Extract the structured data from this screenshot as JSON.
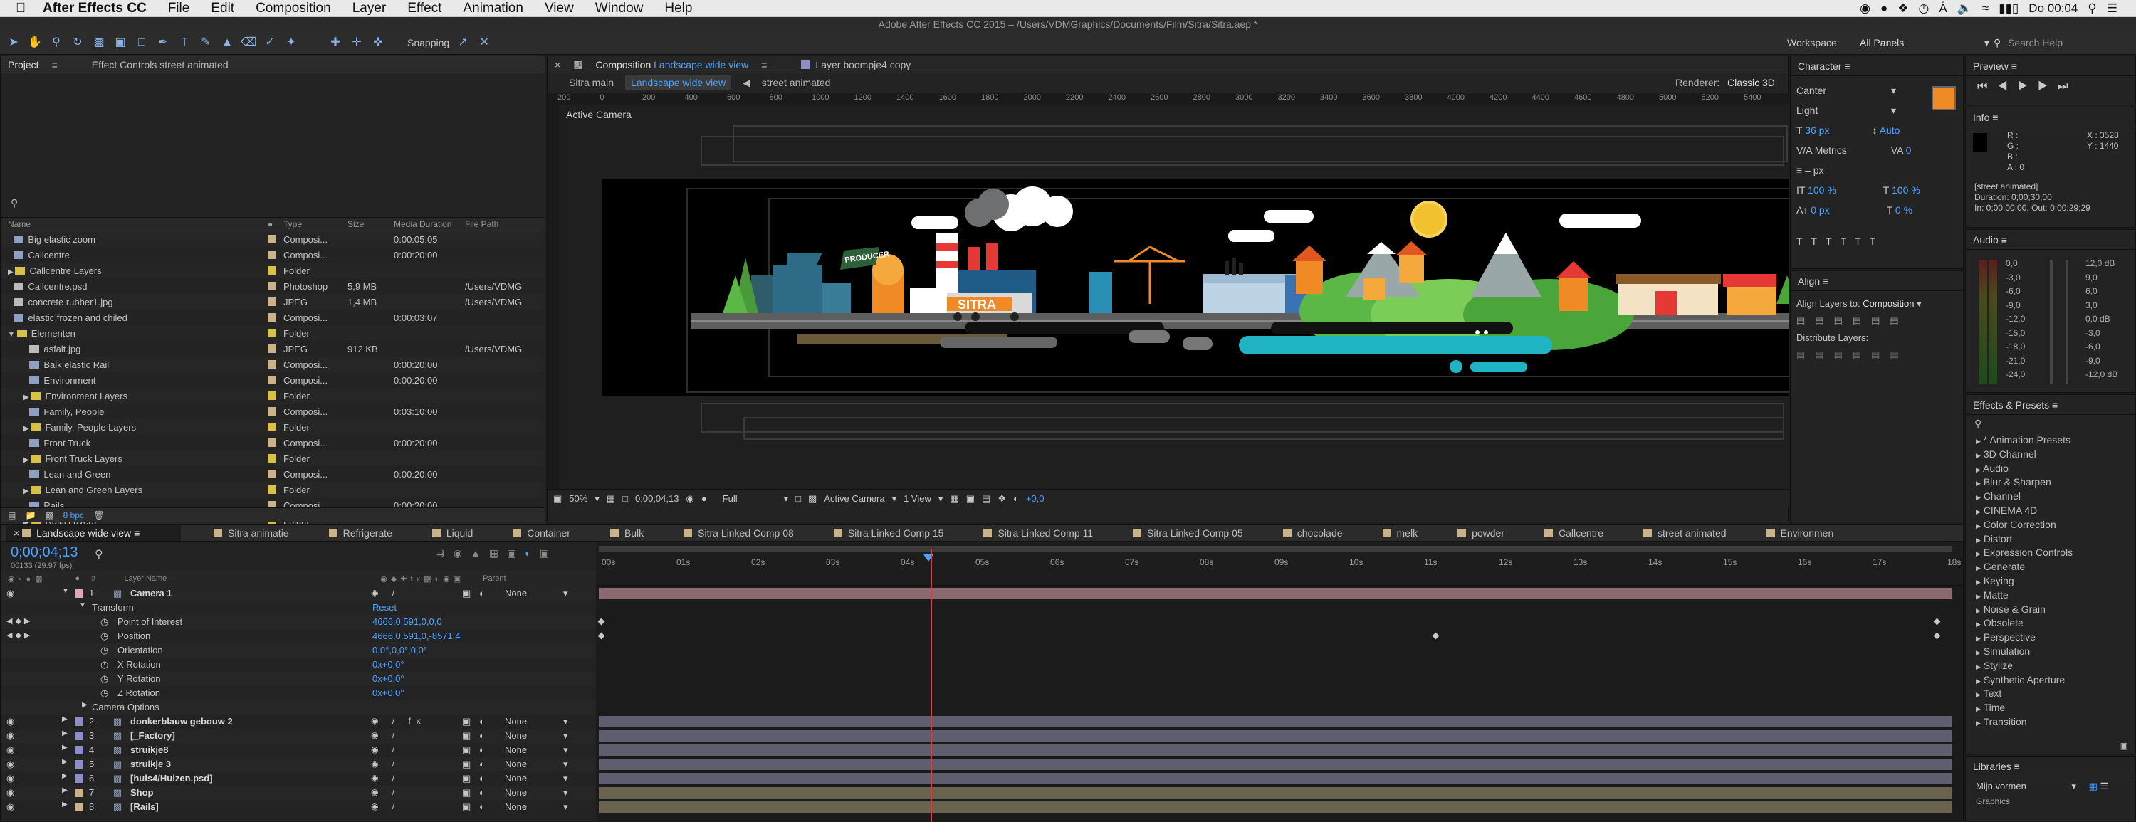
{
  "menubar": {
    "app": "After Effects CC",
    "items": [
      "File",
      "Edit",
      "Composition",
      "Layer",
      "Effect",
      "Animation",
      "View",
      "Window",
      "Help"
    ],
    "clock": "Do 00:04"
  },
  "title": "Adobe After Effects CC 2015 – /Users/VDMGraphics/Documents/Film/Sitra/Sitra.aep *",
  "toolbar": {
    "snapping": "Snapping",
    "workspace_label": "Workspace:",
    "workspace": "All Panels",
    "search": "Search Help"
  },
  "project": {
    "tabs": [
      "Project",
      "Effect Controls street animated"
    ],
    "columns": [
      "Name",
      "Type",
      "Size",
      "Media Duration",
      "File Path"
    ],
    "rows": [
      {
        "name": "Big elastic zoom",
        "type": "Composi...",
        "size": "",
        "dur": "0:00:05:05",
        "path": "",
        "color": "#c9b38a",
        "kind": "comp",
        "indent": 0
      },
      {
        "name": "Callcentre",
        "type": "Composi...",
        "size": "",
        "dur": "0:00:20:00",
        "path": "",
        "color": "#c9b38a",
        "kind": "comp",
        "indent": 0
      },
      {
        "name": "Callcentre Layers",
        "type": "Folder",
        "size": "",
        "dur": "",
        "path": "",
        "color": "#d7c14a",
        "kind": "folder",
        "indent": 0
      },
      {
        "name": "Callcentre.psd",
        "type": "Photoshop",
        "size": "5,9 MB",
        "dur": "",
        "path": "/Users/VDMG",
        "color": "#c9b38a",
        "kind": "file",
        "indent": 0
      },
      {
        "name": "concrete rubber1.jpg",
        "type": "JPEG",
        "size": "1,4 MB",
        "dur": "",
        "path": "/Users/VDMG",
        "color": "#c9b38a",
        "kind": "file",
        "indent": 0
      },
      {
        "name": "elastic frozen and chiled",
        "type": "Composi...",
        "size": "",
        "dur": "0:00:03:07",
        "path": "",
        "color": "#c9b38a",
        "kind": "comp",
        "indent": 0
      },
      {
        "name": "Elementen",
        "type": "Folder",
        "size": "",
        "dur": "",
        "path": "",
        "color": "#d7c14a",
        "kind": "folder-open",
        "indent": 0
      },
      {
        "name": "asfalt.jpg",
        "type": "JPEG",
        "size": "912 KB",
        "dur": "",
        "path": "/Users/VDMG",
        "color": "#c9b38a",
        "kind": "file",
        "indent": 1
      },
      {
        "name": "Balk elastic Rail",
        "type": "Composi...",
        "size": "",
        "dur": "0:00:20:00",
        "path": "",
        "color": "#c9b38a",
        "kind": "comp",
        "indent": 1
      },
      {
        "name": "Environment",
        "type": "Composi...",
        "size": "",
        "dur": "0:00:20:00",
        "path": "",
        "color": "#c9b38a",
        "kind": "comp",
        "indent": 1
      },
      {
        "name": "Environment Layers",
        "type": "Folder",
        "size": "",
        "dur": "",
        "path": "",
        "color": "#d7c14a",
        "kind": "folder",
        "indent": 1
      },
      {
        "name": "Family, People",
        "type": "Composi...",
        "size": "",
        "dur": "0:03:10:00",
        "path": "",
        "color": "#c9b38a",
        "kind": "comp",
        "indent": 1
      },
      {
        "name": "Family, People Layers",
        "type": "Folder",
        "size": "",
        "dur": "",
        "path": "",
        "color": "#d7c14a",
        "kind": "folder",
        "indent": 1
      },
      {
        "name": "Front Truck",
        "type": "Composi...",
        "size": "",
        "dur": "0:00:20:00",
        "path": "",
        "color": "#c9b38a",
        "kind": "comp",
        "indent": 1
      },
      {
        "name": "Front Truck Layers",
        "type": "Folder",
        "size": "",
        "dur": "",
        "path": "",
        "color": "#d7c14a",
        "kind": "folder",
        "indent": 1
      },
      {
        "name": "Lean and Green",
        "type": "Composi...",
        "size": "",
        "dur": "0:00:20:00",
        "path": "",
        "color": "#c9b38a",
        "kind": "comp",
        "indent": 1
      },
      {
        "name": "Lean and Green Layers",
        "type": "Folder",
        "size": "",
        "dur": "",
        "path": "",
        "color": "#d7c14a",
        "kind": "folder",
        "indent": 1
      },
      {
        "name": "Rails",
        "type": "Composi...",
        "size": "",
        "dur": "0:00:20:00",
        "path": "",
        "color": "#c9b38a",
        "kind": "comp",
        "indent": 1
      },
      {
        "name": "Rails Layers",
        "type": "Folder",
        "size": "",
        "dur": "",
        "path": "",
        "color": "#d7c14a",
        "kind": "folder",
        "indent": 1
      }
    ],
    "bpc": "8 bpc"
  },
  "comp": {
    "tab_prefix": "Composition",
    "tab_name": "Landscape wide view",
    "tab2": "Layer boompje4 copy",
    "crumbs": [
      "Sitra main",
      "Landscape wide view",
      "street animated"
    ],
    "renderer_label": "Renderer:",
    "renderer": "Classic 3D",
    "active_camera": "Active Camera",
    "ruler": [
      "200",
      "0",
      "200",
      "400",
      "600",
      "800",
      "1000",
      "1200",
      "1400",
      "1600",
      "1800",
      "2000",
      "2200",
      "2400",
      "2600",
      "2800",
      "3000",
      "3200",
      "3400",
      "3600",
      "3800",
      "4000",
      "4200",
      "4400",
      "4600",
      "4800",
      "5000",
      "5200",
      "5400"
    ],
    "footer": {
      "zoom": "50%",
      "timecode": "0;00;04;13",
      "resolution": "Full",
      "camera": "Active Camera",
      "views": "1 View",
      "exposure": "+0,0"
    },
    "sign": "PRODUCER",
    "truck": "SITRA"
  },
  "character": {
    "title": "Character",
    "font": "Canter",
    "style": "Light",
    "size": "36 px",
    "leading": "Auto",
    "kerning": "Metrics",
    "tracking": "0",
    "line": "– px",
    "vscale": "100 %",
    "hscale": "100 %",
    "baseline": "0 px",
    "tsume": "0 %",
    "fill": "#f08a24"
  },
  "align": {
    "title": "Align",
    "align_to_label": "Align Layers to:",
    "align_to": "Composition",
    "distribute": "Distribute Layers:"
  },
  "preview": {
    "title": "Preview"
  },
  "info": {
    "title": "Info",
    "r": "R :",
    "g": "G :",
    "b": "B :",
    "a": "A : 0",
    "x": "X : 3528",
    "y": "Y : 1440",
    "layer": "[street animated]",
    "duration": "Duration: 0;00;30;00",
    "inout": "In: 0;00;00;00, Out: 0;00;29;29"
  },
  "audio": {
    "title": "Audio",
    "left": [
      "0,0",
      "-3,0",
      "-6,0",
      "-9,0",
      "-12,0",
      "-15,0",
      "-18,0",
      "-21,0",
      "-24,0"
    ],
    "right": [
      "12,0 dB",
      "9,0",
      "6,0",
      "3,0",
      "0,0 dB",
      "-3,0",
      "-6,0",
      "-9,0",
      "-12,0 dB"
    ]
  },
  "effects": {
    "title": "Effects & Presets",
    "items": [
      "* Animation Presets",
      "3D Channel",
      "Audio",
      "Blur & Sharpen",
      "Channel",
      "CINEMA 4D",
      "Color Correction",
      "Distort",
      "Expression Controls",
      "Generate",
      "Keying",
      "Matte",
      "Noise & Grain",
      "Obsolete",
      "Perspective",
      "Simulation",
      "Stylize",
      "Synthetic Aperture",
      "Text",
      "Time",
      "Transition"
    ]
  },
  "libraries": {
    "title": "Libraries",
    "selected": "Mijn vormen",
    "section": "Graphics"
  },
  "timeline": {
    "tabs": [
      {
        "label": "Landscape wide view",
        "color": "#c9b38a"
      },
      {
        "label": "Sitra animatie",
        "color": "#c9b38a"
      },
      {
        "label": "Refrigerate",
        "color": "#c9b38a"
      },
      {
        "label": "Liquid",
        "color": "#c9b38a"
      },
      {
        "label": "Container",
        "color": "#c9b38a"
      },
      {
        "label": "Bulk",
        "color": "#c9b38a"
      },
      {
        "label": "Sitra Linked Comp 08",
        "color": "#c9b38a"
      },
      {
        "label": "Sitra Linked Comp 15",
        "color": "#c9b38a"
      },
      {
        "label": "Sitra Linked Comp 11",
        "color": "#c9b38a"
      },
      {
        "label": "Sitra Linked Comp 05",
        "color": "#c9b38a"
      },
      {
        "label": "chocolade",
        "color": "#c9b38a"
      },
      {
        "label": "melk",
        "color": "#c9b38a"
      },
      {
        "label": "powder",
        "color": "#c9b38a"
      },
      {
        "label": "Callcentre",
        "color": "#c9b38a"
      },
      {
        "label": "street animated",
        "color": "#c9b38a"
      },
      {
        "label": "Environmen",
        "color": "#c9b38a"
      }
    ],
    "timecode": "0;00;04;13",
    "fps": "00133 (29.97 fps)",
    "headers": {
      "num": "#",
      "layer": "Layer Name",
      "parent": "Parent"
    },
    "ticks": [
      "00s",
      "01s",
      "02s",
      "03s",
      "04s",
      "05s",
      "06s",
      "07s",
      "08s",
      "09s",
      "10s",
      "11s",
      "12s",
      "13s",
      "14s",
      "15s",
      "16s",
      "17s",
      "18s"
    ],
    "rows": [
      {
        "kind": "layer",
        "num": "1",
        "name": "Camera 1",
        "parent": "None",
        "color": "#e3a8b8",
        "open": true
      },
      {
        "kind": "group",
        "name": "Transform",
        "value": "Reset"
      },
      {
        "kind": "prop",
        "name": "Point of Interest",
        "value": "4666,0,591,0,0,0",
        "key": true
      },
      {
        "kind": "prop",
        "name": "Position",
        "value": "4666,0,591,0,-8571,4",
        "key": true
      },
      {
        "kind": "prop",
        "name": "Orientation",
        "value": "0,0°,0,0°,0,0°"
      },
      {
        "kind": "prop",
        "name": "X Rotation",
        "value": "0x+0,0°"
      },
      {
        "kind": "prop",
        "name": "Y Rotation",
        "value": "0x+0,0°"
      },
      {
        "kind": "prop",
        "name": "Z Rotation",
        "value": "0x+0,0°"
      },
      {
        "kind": "group2",
        "name": "Camera Options"
      },
      {
        "kind": "layer",
        "num": "2",
        "name": "donkerblauw gebouw 2",
        "parent": "None",
        "color": "#8e8ec9",
        "fx": true
      },
      {
        "kind": "layer",
        "num": "3",
        "name": "[_Factory]",
        "parent": "None",
        "color": "#8e8ec9"
      },
      {
        "kind": "layer",
        "num": "4",
        "name": "struikje8",
        "parent": "None",
        "color": "#8e8ec9"
      },
      {
        "kind": "layer",
        "num": "5",
        "name": "struikje 3",
        "parent": "None",
        "color": "#8e8ec9"
      },
      {
        "kind": "layer",
        "num": "6",
        "name": "[huis4/Huizen.psd]",
        "parent": "None",
        "color": "#8e8ec9"
      },
      {
        "kind": "layer",
        "num": "7",
        "name": "Shop",
        "parent": "None",
        "color": "#c9b38a"
      },
      {
        "kind": "layer",
        "num": "8",
        "name": "[Rails]",
        "parent": "None",
        "color": "#c9b38a"
      }
    ]
  }
}
